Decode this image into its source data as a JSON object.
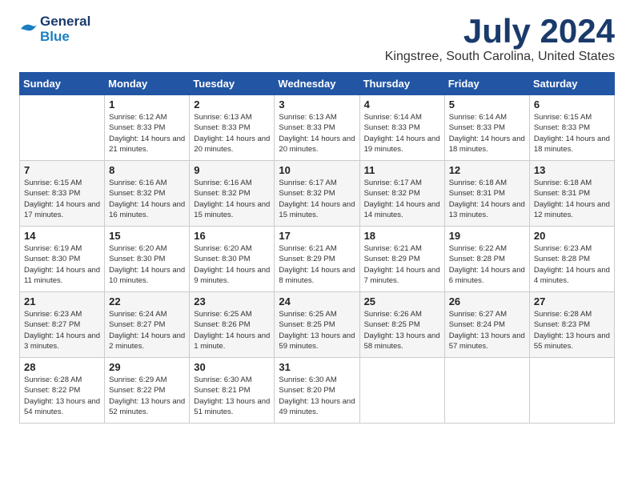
{
  "header": {
    "logo_line1": "General",
    "logo_line2": "Blue",
    "month": "July 2024",
    "location": "Kingstree, South Carolina, United States"
  },
  "days_of_week": [
    "Sunday",
    "Monday",
    "Tuesday",
    "Wednesday",
    "Thursday",
    "Friday",
    "Saturday"
  ],
  "weeks": [
    [
      {
        "day": "",
        "info": ""
      },
      {
        "day": "1",
        "info": "Sunrise: 6:12 AM\nSunset: 8:33 PM\nDaylight: 14 hours\nand 21 minutes."
      },
      {
        "day": "2",
        "info": "Sunrise: 6:13 AM\nSunset: 8:33 PM\nDaylight: 14 hours\nand 20 minutes."
      },
      {
        "day": "3",
        "info": "Sunrise: 6:13 AM\nSunset: 8:33 PM\nDaylight: 14 hours\nand 20 minutes."
      },
      {
        "day": "4",
        "info": "Sunrise: 6:14 AM\nSunset: 8:33 PM\nDaylight: 14 hours\nand 19 minutes."
      },
      {
        "day": "5",
        "info": "Sunrise: 6:14 AM\nSunset: 8:33 PM\nDaylight: 14 hours\nand 18 minutes."
      },
      {
        "day": "6",
        "info": "Sunrise: 6:15 AM\nSunset: 8:33 PM\nDaylight: 14 hours\nand 18 minutes."
      }
    ],
    [
      {
        "day": "7",
        "info": "Sunrise: 6:15 AM\nSunset: 8:33 PM\nDaylight: 14 hours\nand 17 minutes."
      },
      {
        "day": "8",
        "info": "Sunrise: 6:16 AM\nSunset: 8:32 PM\nDaylight: 14 hours\nand 16 minutes."
      },
      {
        "day": "9",
        "info": "Sunrise: 6:16 AM\nSunset: 8:32 PM\nDaylight: 14 hours\nand 15 minutes."
      },
      {
        "day": "10",
        "info": "Sunrise: 6:17 AM\nSunset: 8:32 PM\nDaylight: 14 hours\nand 15 minutes."
      },
      {
        "day": "11",
        "info": "Sunrise: 6:17 AM\nSunset: 8:32 PM\nDaylight: 14 hours\nand 14 minutes."
      },
      {
        "day": "12",
        "info": "Sunrise: 6:18 AM\nSunset: 8:31 PM\nDaylight: 14 hours\nand 13 minutes."
      },
      {
        "day": "13",
        "info": "Sunrise: 6:18 AM\nSunset: 8:31 PM\nDaylight: 14 hours\nand 12 minutes."
      }
    ],
    [
      {
        "day": "14",
        "info": "Sunrise: 6:19 AM\nSunset: 8:30 PM\nDaylight: 14 hours\nand 11 minutes."
      },
      {
        "day": "15",
        "info": "Sunrise: 6:20 AM\nSunset: 8:30 PM\nDaylight: 14 hours\nand 10 minutes."
      },
      {
        "day": "16",
        "info": "Sunrise: 6:20 AM\nSunset: 8:30 PM\nDaylight: 14 hours\nand 9 minutes."
      },
      {
        "day": "17",
        "info": "Sunrise: 6:21 AM\nSunset: 8:29 PM\nDaylight: 14 hours\nand 8 minutes."
      },
      {
        "day": "18",
        "info": "Sunrise: 6:21 AM\nSunset: 8:29 PM\nDaylight: 14 hours\nand 7 minutes."
      },
      {
        "day": "19",
        "info": "Sunrise: 6:22 AM\nSunset: 8:28 PM\nDaylight: 14 hours\nand 6 minutes."
      },
      {
        "day": "20",
        "info": "Sunrise: 6:23 AM\nSunset: 8:28 PM\nDaylight: 14 hours\nand 4 minutes."
      }
    ],
    [
      {
        "day": "21",
        "info": "Sunrise: 6:23 AM\nSunset: 8:27 PM\nDaylight: 14 hours\nand 3 minutes."
      },
      {
        "day": "22",
        "info": "Sunrise: 6:24 AM\nSunset: 8:27 PM\nDaylight: 14 hours\nand 2 minutes."
      },
      {
        "day": "23",
        "info": "Sunrise: 6:25 AM\nSunset: 8:26 PM\nDaylight: 14 hours\nand 1 minute."
      },
      {
        "day": "24",
        "info": "Sunrise: 6:25 AM\nSunset: 8:25 PM\nDaylight: 13 hours\nand 59 minutes."
      },
      {
        "day": "25",
        "info": "Sunrise: 6:26 AM\nSunset: 8:25 PM\nDaylight: 13 hours\nand 58 minutes."
      },
      {
        "day": "26",
        "info": "Sunrise: 6:27 AM\nSunset: 8:24 PM\nDaylight: 13 hours\nand 57 minutes."
      },
      {
        "day": "27",
        "info": "Sunrise: 6:28 AM\nSunset: 8:23 PM\nDaylight: 13 hours\nand 55 minutes."
      }
    ],
    [
      {
        "day": "28",
        "info": "Sunrise: 6:28 AM\nSunset: 8:22 PM\nDaylight: 13 hours\nand 54 minutes."
      },
      {
        "day": "29",
        "info": "Sunrise: 6:29 AM\nSunset: 8:22 PM\nDaylight: 13 hours\nand 52 minutes."
      },
      {
        "day": "30",
        "info": "Sunrise: 6:30 AM\nSunset: 8:21 PM\nDaylight: 13 hours\nand 51 minutes."
      },
      {
        "day": "31",
        "info": "Sunrise: 6:30 AM\nSunset: 8:20 PM\nDaylight: 13 hours\nand 49 minutes."
      },
      {
        "day": "",
        "info": ""
      },
      {
        "day": "",
        "info": ""
      },
      {
        "day": "",
        "info": ""
      }
    ]
  ]
}
